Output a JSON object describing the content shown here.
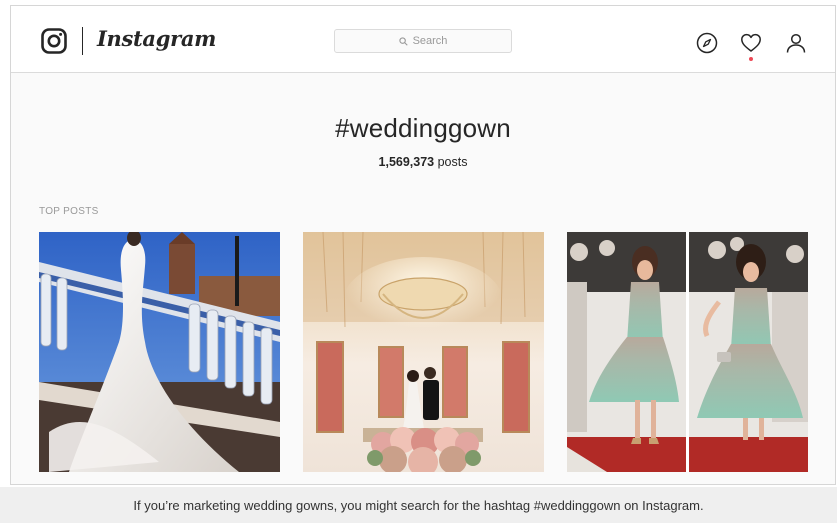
{
  "header": {
    "wordmark": "Instagram",
    "search": {
      "placeholder": "Search"
    },
    "icons": [
      "instagram-glyph-icon",
      "explore-compass-icon",
      "activity-heart-icon",
      "profile-icon"
    ],
    "notification_dot_color": "#ed4956"
  },
  "hashtag_page": {
    "title": "#weddinggown",
    "post_count": "1,569,373",
    "post_count_suffix": " posts",
    "section_label": "TOP POSTS",
    "top_posts": [
      {
        "subject": "bride in white mermaid gown on ornate balustrade under blue sky"
      },
      {
        "subject": "couple kissing under chandelier with floral decorations"
      },
      {
        "subject": "woman in mint sequined cocktail dress on red carpet"
      }
    ]
  },
  "caption": "If you’re marketing wedding gowns, you might search for the hashtag #weddinggown on Instagram.",
  "colors": {
    "background": "#fafafa",
    "border": "#dbdbdb",
    "text": "#262626",
    "muted": "#999999"
  }
}
